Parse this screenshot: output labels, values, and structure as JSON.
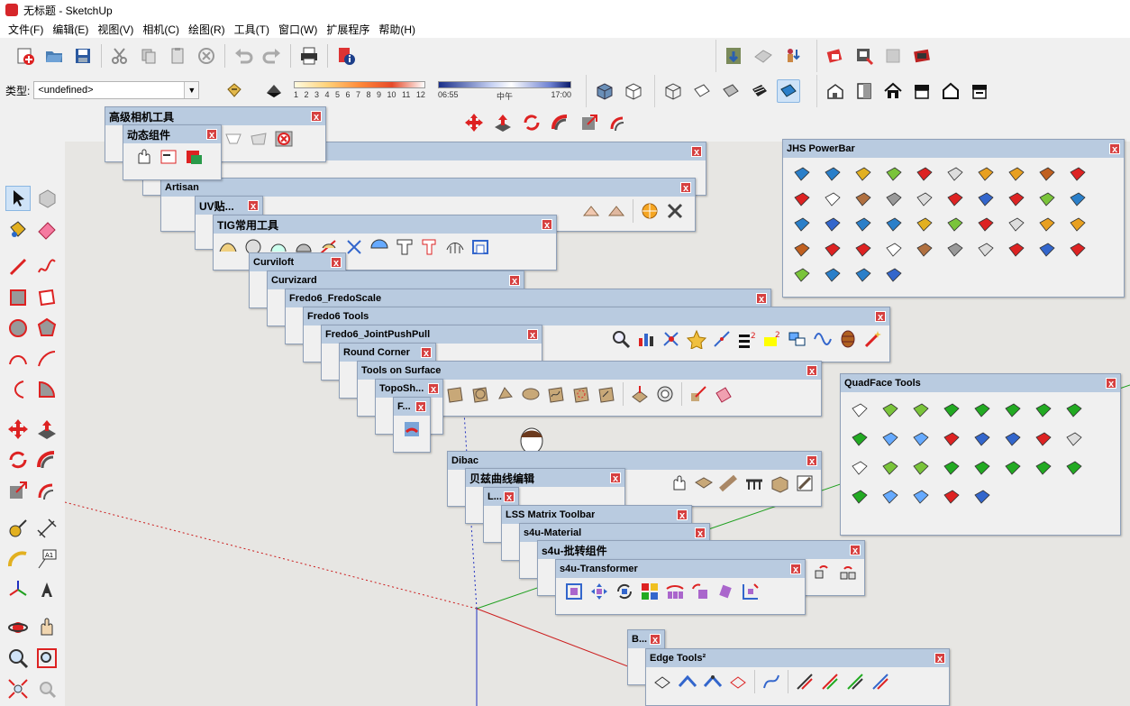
{
  "window": {
    "title": "无标题 - SketchUp"
  },
  "menu": [
    "文件(F)",
    "编辑(E)",
    "视图(V)",
    "相机(C)",
    "绘图(R)",
    "工具(T)",
    "窗口(W)",
    "扩展程序",
    "帮助(H)"
  ],
  "type_combo": {
    "label": "类型:",
    "value": "<undefined>"
  },
  "shadow": {
    "months": [
      "1",
      "2",
      "3",
      "4",
      "5",
      "6",
      "7",
      "8",
      "9",
      "10",
      "11",
      "12"
    ]
  },
  "time": {
    "start": "06:55",
    "mid": "中午",
    "end": "17:00"
  },
  "palettes": {
    "advanced_camera": "高级相机工具",
    "dynamic_components": "动态组件",
    "artisan": "Artisan",
    "uv": "UV贴...",
    "tig": "TIG常用工具",
    "curviloft": "Curviloft",
    "curvizard": "Curvizard",
    "fredoscale": "Fredo6_FredoScale",
    "fredo_tools": "Fredo6 Tools",
    "jointpushpull": "Fredo6_JointPushPull",
    "round_corner": "Round Corner",
    "tools_on_surface": "Tools on Surface",
    "toposh": "TopoSh...",
    "f": "F...",
    "jhs": "JHS PowerBar",
    "quadface": "QuadFace Tools",
    "dibac": "Dibac",
    "bezier": "贝兹曲线编辑",
    "l": "L...",
    "lss": "LSS Matrix Toolbar",
    "s4u_material": "s4u-Material",
    "s4u_flip": "s4u-批转组件",
    "s4u_transformer": "s4u-Transformer",
    "b": "B...",
    "edge_tools": "Edge Tools²"
  },
  "close_glyph": "x",
  "colors": {
    "palette_header": "#b9cbe0",
    "close": "#d64040",
    "viewport": "#e7e6e3",
    "axis_red": "#cc2020",
    "axis_green": "#20a020",
    "axis_blue": "#2030c0"
  }
}
